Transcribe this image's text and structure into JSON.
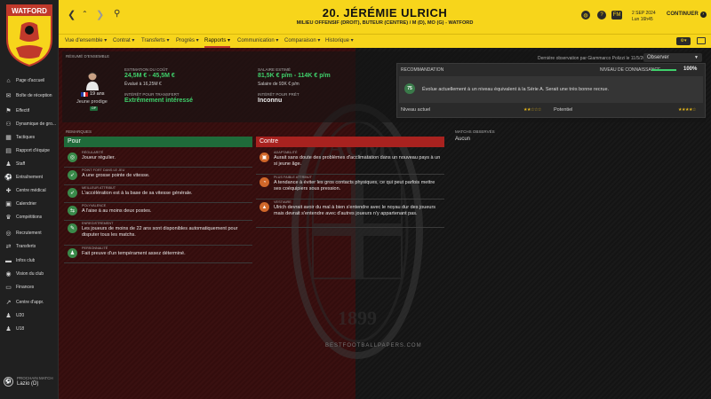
{
  "app": {
    "club": "WATFORD"
  },
  "header": {
    "title": "20. JÉRÉMIE ULRICH",
    "subtitle": "MILIEU OFFENSIF (DROIT), BUTEUR (CENTRE) / M (D), MO (G) - WATFORD",
    "date": "2 SEP 2024",
    "time": "Lun 16h45",
    "continue_label": "CONTINUER"
  },
  "tabs": [
    {
      "label": "Vue d'ensemble ▾"
    },
    {
      "label": "Contrat ▾"
    },
    {
      "label": "Transferts ▾"
    },
    {
      "label": "Progrès ▾"
    },
    {
      "label": "Rapports ▾"
    },
    {
      "label": "Communication ▾"
    },
    {
      "label": "Comparaison ▾"
    },
    {
      "label": "Historique ▾"
    }
  ],
  "active_tab": "Rapports ▾",
  "sidebar": {
    "items": [
      {
        "label": "Page d'accueil",
        "icon": "home-icon",
        "glyph": "⌂"
      },
      {
        "label": "Boîte de réception",
        "icon": "inbox-icon",
        "glyph": "✉"
      },
      {
        "label": "Effectif",
        "icon": "squad-icon",
        "glyph": "⚑"
      },
      {
        "label": "Dynamique de gro...",
        "icon": "group-dynamics-icon",
        "glyph": "⚇"
      },
      {
        "label": "Tactiques",
        "icon": "tactics-icon",
        "glyph": "▦"
      },
      {
        "label": "Rapport d'équipe",
        "icon": "team-report-icon",
        "glyph": "▤"
      },
      {
        "label": "Staff",
        "icon": "staff-icon",
        "glyph": "♟"
      },
      {
        "label": "Entraînement",
        "icon": "training-icon",
        "glyph": "⚽"
      },
      {
        "label": "Centre médical",
        "icon": "medical-icon",
        "glyph": "✚"
      },
      {
        "label": "Calendrier",
        "icon": "calendar-icon",
        "glyph": "▣"
      },
      {
        "label": "Compétitions",
        "icon": "competitions-icon",
        "glyph": "♛"
      },
      {
        "label": "Recrutement",
        "icon": "scouting-icon",
        "glyph": "◎"
      },
      {
        "label": "Transferts",
        "icon": "transfers-icon",
        "glyph": "⇄"
      },
      {
        "label": "Infos club",
        "icon": "club-info-icon",
        "glyph": "▬"
      },
      {
        "label": "Vision du club",
        "icon": "club-vision-icon",
        "glyph": "◉"
      },
      {
        "label": "Finances",
        "icon": "finances-icon",
        "glyph": "▭"
      },
      {
        "label": "Centre d'appr.",
        "icon": "development-centre-icon",
        "glyph": "↗"
      },
      {
        "label": "U20",
        "icon": "u20-icon",
        "glyph": "♟"
      },
      {
        "label": "U18",
        "icon": "u18-icon",
        "glyph": "♟"
      }
    ],
    "next_match_label": "PROCHAIN MATCH",
    "next_match_value": "Lazio (D)"
  },
  "overview": {
    "section_label": "RÉSUMÉ D'ENSEMBLE",
    "last_observation": "Dernière observation par Giammarco Polizzi le 11/5/2024",
    "observe_label": "Observer",
    "age": "19 ans",
    "potential": "Jeune prodige",
    "potential_badge": "OP",
    "cost_label": "ESTIMATION DU COÛT",
    "cost_value": "24,5M € - 45,5M €",
    "cost_eval": "Évalué à 16,25M €",
    "transfer_label": "INTÉRÊT POUR TRANSFERT",
    "transfer_value": "Extrêmement intéressé",
    "salary_label": "SALAIRE ESTIMÉ",
    "salary_value": "81,5K € p/m - 114K € p/m",
    "salary_current": "Salaire de 93K € p/m",
    "loan_label": "INTÉRÊT POUR PRÊT",
    "loan_value": "Inconnu"
  },
  "recommendation": {
    "label": "RECOMMANDATION",
    "knowledge_label": "NIVEAU DE CONNAISSANCE",
    "knowledge_value": "100%",
    "knowledge_fraction": 1.0,
    "score": "75",
    "text": "Évolue actuellement à un niveau équivalent à la Série A. Serait une très bonne recrue.",
    "current_label": "Niveau actuel",
    "current_stars": "★★☆☆☆",
    "potential_label": "Potentiel",
    "potential_stars": "★★★★☆"
  },
  "notes": {
    "label": "REMARQUES",
    "pour_label": "Pour",
    "contre_label": "Contre",
    "pour": [
      {
        "cat": "RÉGULARITÉ",
        "text": "Joueur régulier.",
        "icon": "consistency-icon",
        "glyph": "◎"
      },
      {
        "cat": "POINT FORT DANS LE JEU",
        "text": "A une grosse pointe de vitesse.",
        "icon": "speed-icon",
        "glyph": "➶"
      },
      {
        "cat": "MEILLEUR ATTRIBUT",
        "text": "L'accélération est à la base de sa vitesse générale.",
        "icon": "acceleration-icon",
        "glyph": "➶"
      },
      {
        "cat": "POLYVALENCE",
        "text": "A l'aise à au moins deux postes.",
        "icon": "versatility-icon",
        "glyph": "⇆"
      },
      {
        "cat": "ENREGISTREMENT",
        "text": "Les joueurs de moins de 22 ans sont disponibles automatiquement pour disputer tous les matchs.",
        "icon": "registration-icon",
        "glyph": "✎"
      },
      {
        "cat": "PERSONNALITÉ",
        "text": "Fait preuve d'un tempérament assez déterminé.",
        "icon": "personality-icon",
        "glyph": "♟"
      }
    ],
    "contre": [
      {
        "cat": "ADAPTABILITÉ",
        "text": "Aurait sans doute des problèmes d'acclimatation dans un nouveau pays à un si jeune âge.",
        "icon": "adaptability-icon",
        "glyph": "▣"
      },
      {
        "cat": "PLUS FAIBLE ATTRIBUT",
        "text": "A tendance à éviter les gros contacts physiques, ce qui peut parfois mettre ses coéquipiers sous pression.",
        "icon": "weakness-icon",
        "glyph": "◔"
      },
      {
        "cat": "VESTIAIRE",
        "text": "Ulrich devrait avoir du mal à bien s'entendre avec le noyau dur des joueurs mais devrait s'entendre avec d'autres joueurs n'y appartenant pas.",
        "icon": "dressing-room-icon",
        "glyph": "▲"
      }
    ]
  },
  "matches": {
    "label": "MATCHS OBSERVÉS",
    "value": "Aucun"
  },
  "watermark": "BESTFOOTBALLPAPERS.COM",
  "colors": {
    "header": "#f7d51b",
    "green": "#1f6b3a",
    "red": "#a8221f",
    "accent_green": "#3fd06b"
  }
}
